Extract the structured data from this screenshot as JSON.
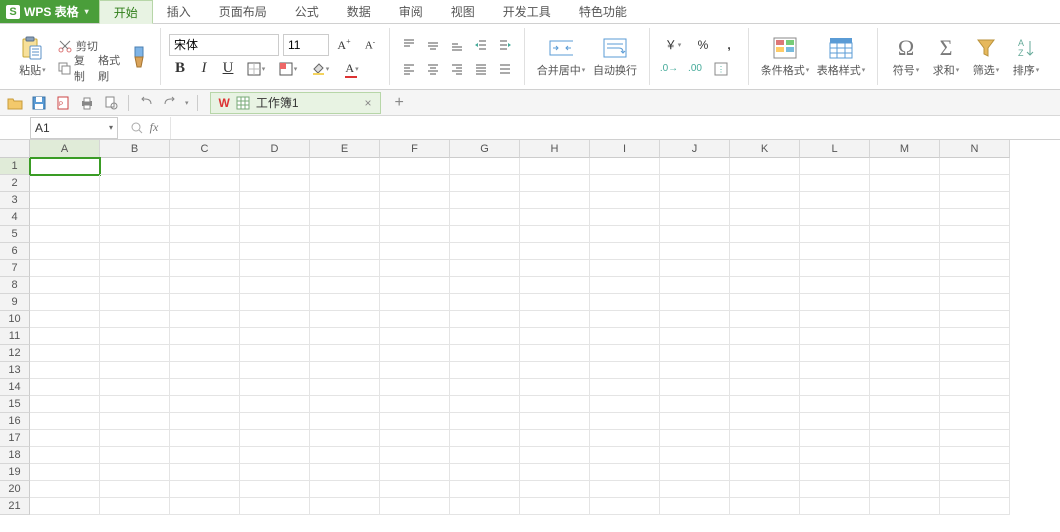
{
  "app": {
    "name": "WPS 表格"
  },
  "menu": {
    "tabs": [
      "开始",
      "插入",
      "页面布局",
      "公式",
      "数据",
      "审阅",
      "视图",
      "开发工具",
      "特色功能"
    ],
    "active_index": 0
  },
  "ribbon": {
    "paste": "粘贴",
    "cut": "剪切",
    "copy": "复制",
    "format_painter": "格式刷",
    "font_name": "宋体",
    "font_size": "11",
    "merge_center": "合并居中",
    "wrap_text": "自动换行",
    "currency_sym": "￥",
    "percent_sym": "%",
    "cond_format": "条件格式",
    "table_style": "表格样式",
    "symbol": "符号",
    "sum": "求和",
    "filter": "筛选",
    "sort": "排序"
  },
  "doc": {
    "name": "工作簿1"
  },
  "namebox": {
    "ref": "A1"
  },
  "columns": [
    "A",
    "B",
    "C",
    "D",
    "E",
    "F",
    "G",
    "H",
    "I",
    "J",
    "K",
    "L",
    "M",
    "N"
  ],
  "row_count": 21,
  "active_cell": {
    "row": 1,
    "col": 0
  }
}
